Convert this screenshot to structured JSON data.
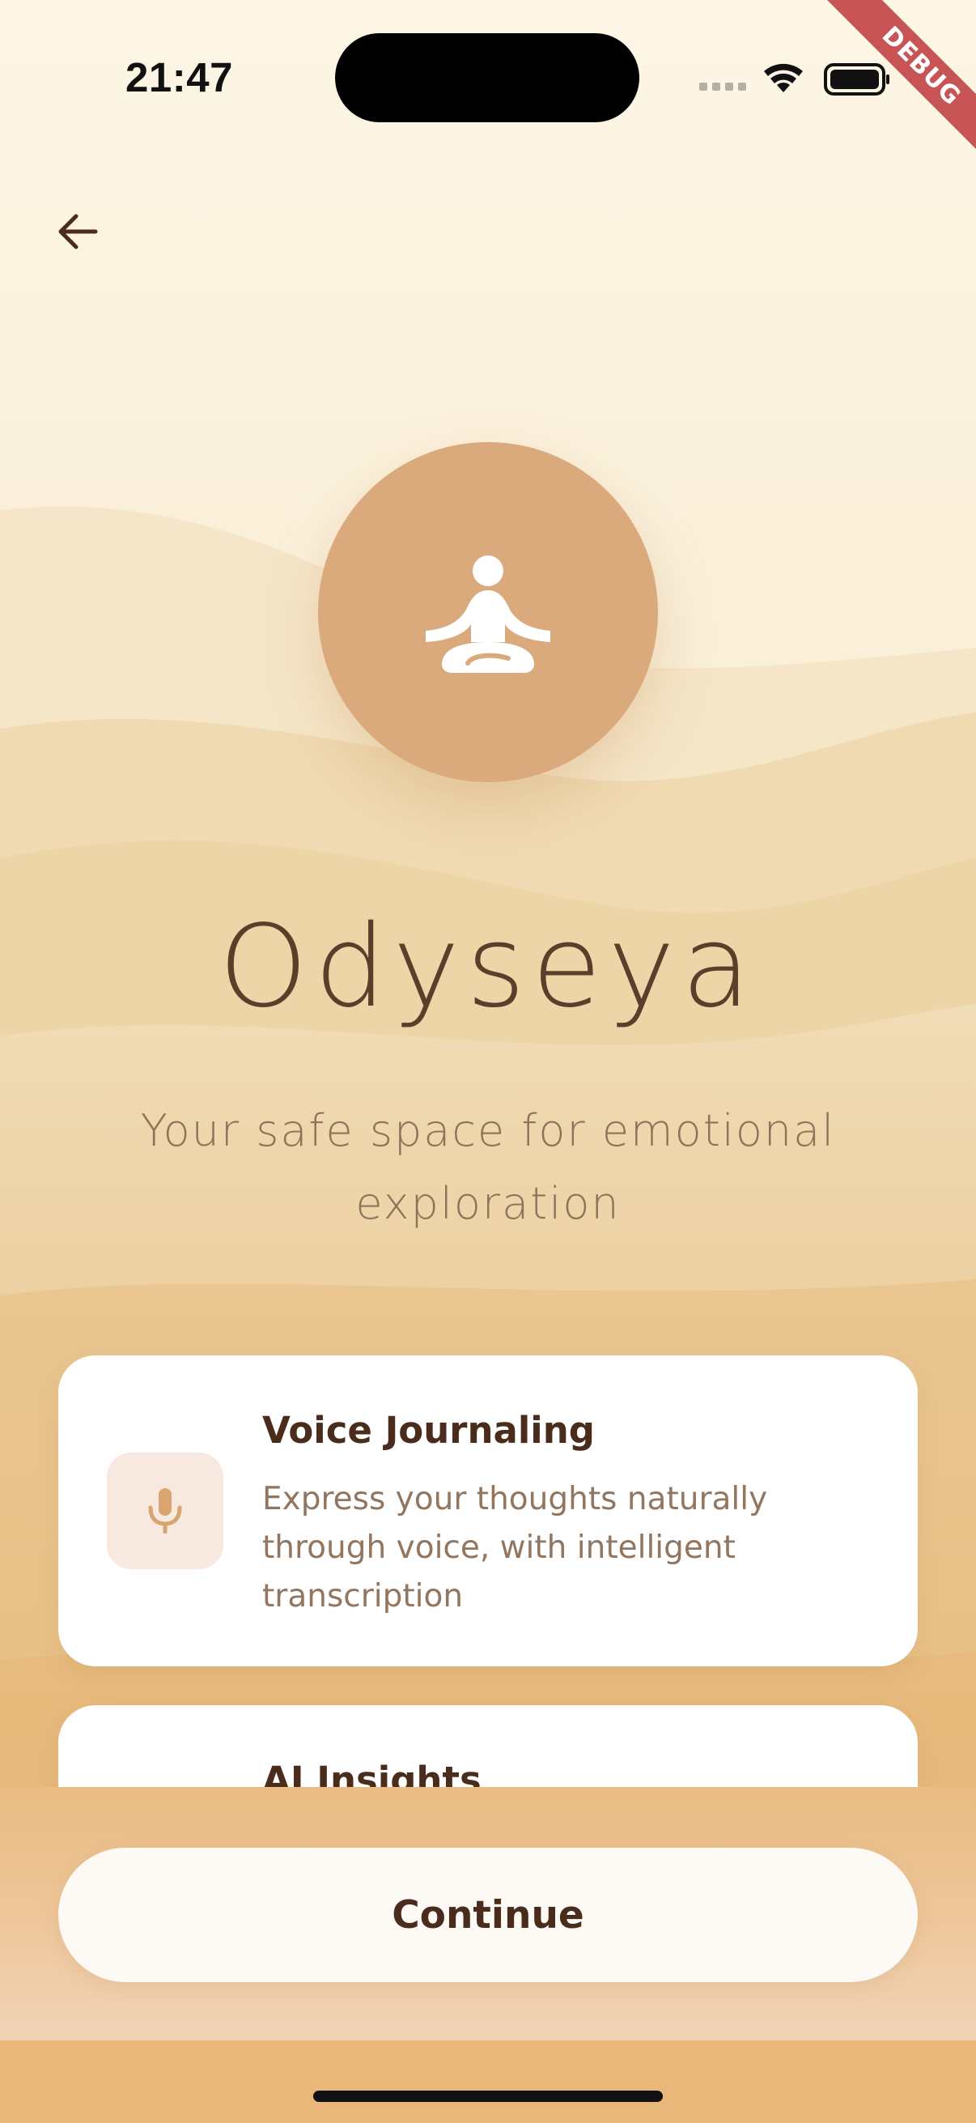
{
  "status_bar": {
    "time": "21:47",
    "signal_icon": "cellular-signal-icon",
    "wifi_icon": "wifi-icon",
    "battery_icon": "battery-icon"
  },
  "debug_banner": {
    "label": "DEBUG",
    "color": "#c85555"
  },
  "nav": {
    "back_icon": "arrow-left-icon"
  },
  "hero": {
    "logo_icon": "meditation-person-icon",
    "title": "Odyseya",
    "tagline": "Your safe space for emotional exploration"
  },
  "features": [
    {
      "icon": "microphone-icon",
      "title": "Voice Journaling",
      "description": "Express your thoughts naturally through voice, with intelligent transcription"
    },
    {
      "title": "AI Insights"
    }
  ],
  "actions": {
    "continue_label": "Continue"
  },
  "colors": {
    "accent": "#dbaa7c",
    "title_text": "#5a3f2a",
    "dark_text": "#4a2c1d",
    "muted_text": "#93765f",
    "icon_tint": "#d8a46f"
  }
}
